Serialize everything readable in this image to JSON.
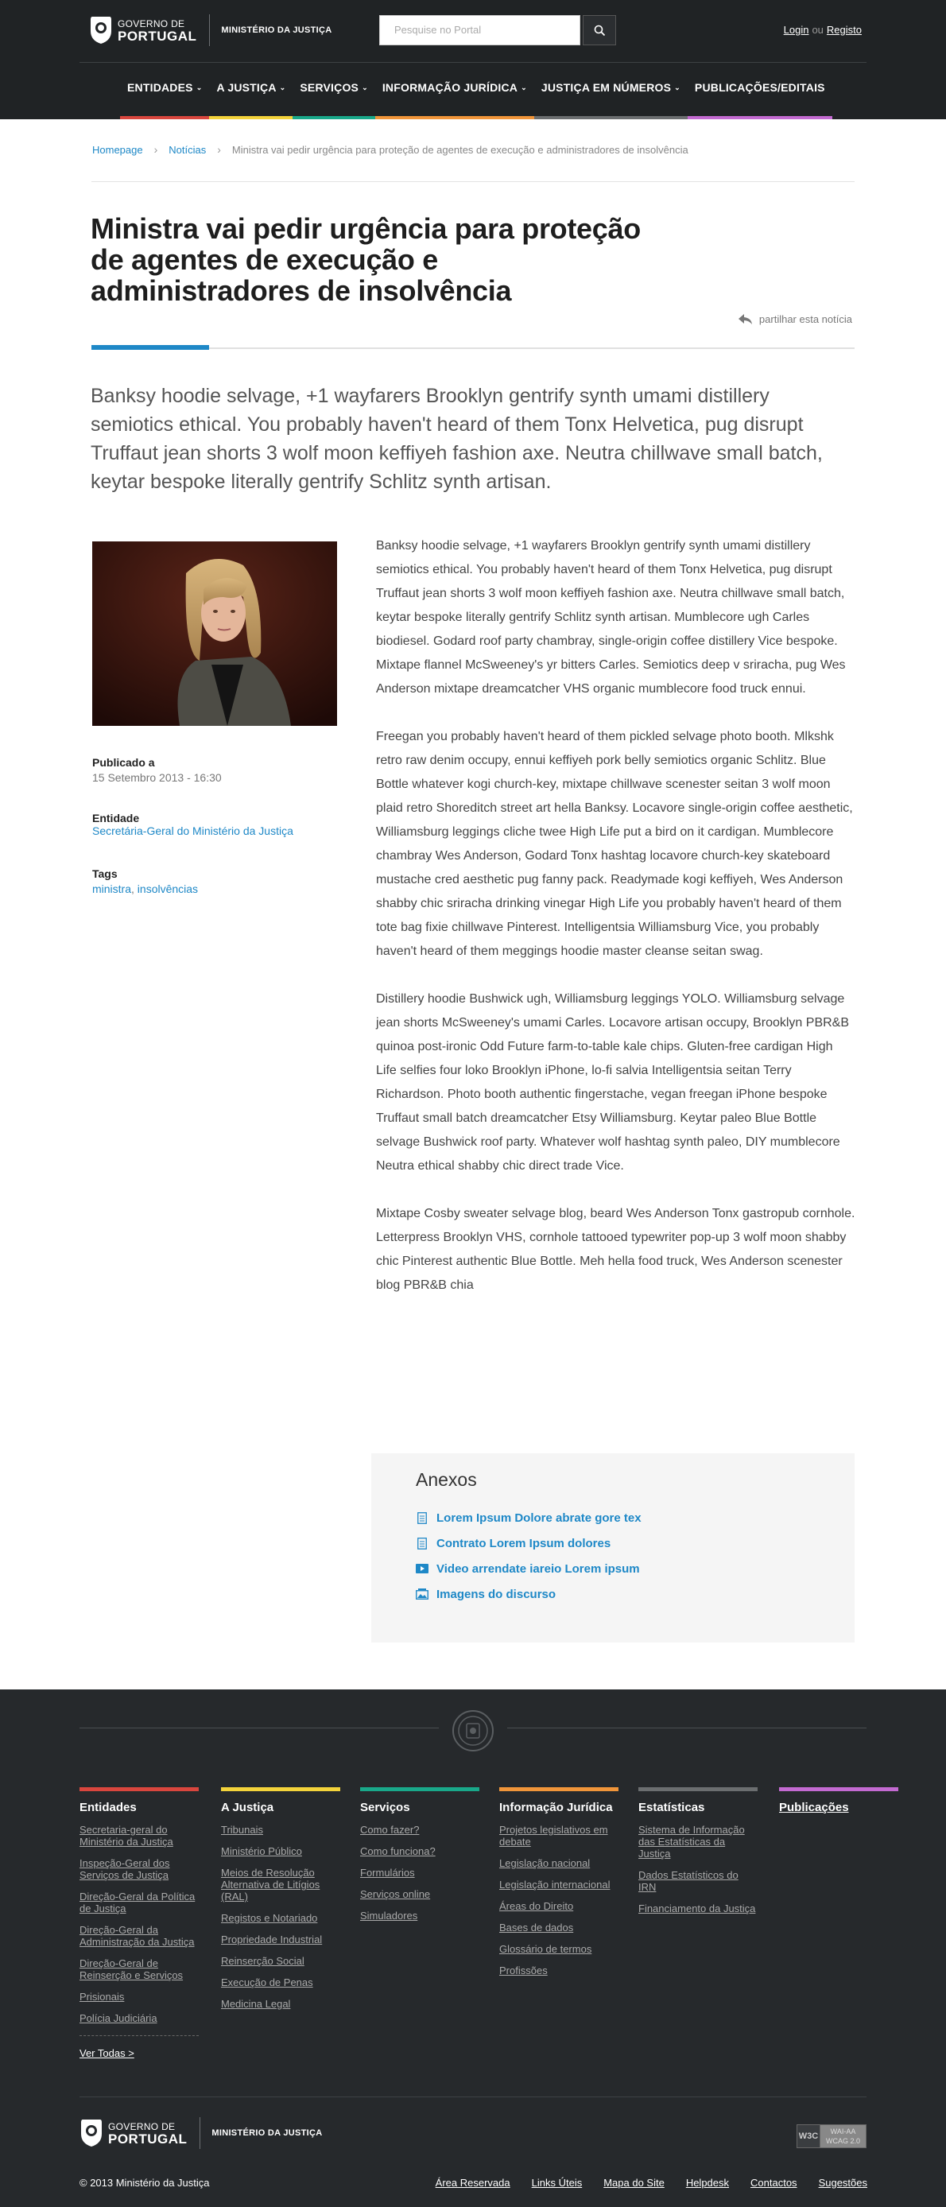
{
  "header": {
    "logo_line1": "GOVERNO DE",
    "logo_line2": "PORTUGAL",
    "ministry": "MINISTÉRIO DA JUSTIÇA",
    "search_placeholder": "Pesquise no Portal",
    "login": "Login",
    "ou": "ou",
    "register": "Registo"
  },
  "nav": [
    {
      "label": "ENTIDADES",
      "color": "#d9463e",
      "dropdown": true
    },
    {
      "label": "A JUSTIÇA",
      "color": "#f3d33b",
      "dropdown": true
    },
    {
      "label": "SERVIÇOS",
      "color": "#19a88a",
      "dropdown": true
    },
    {
      "label": "INFORMAÇÃO JURÍDICA",
      "color": "#f0953a",
      "dropdown": true
    },
    {
      "label": "JUSTIÇA EM NÚMEROS",
      "color": "#6b6e70",
      "dropdown": true
    },
    {
      "label": "PUBLICAÇÕES/EDITAIS",
      "color": "#c36ad1",
      "dropdown": false
    }
  ],
  "breadcrumb": {
    "home": "Homepage",
    "news": "Notícias",
    "current": "Ministra vai pedir urgência para proteção  de agentes de execução e administradores de insolvência"
  },
  "article": {
    "title": "Ministra vai pedir urgência para proteção de agentes de execução e administradores de insolvência",
    "share": "partilhar esta notícia",
    "lead": "Banksy hoodie selvage, +1 wayfarers Brooklyn gentrify synth umami distillery semiotics ethical. You probably haven't heard of them Tonx Helvetica, pug disrupt Truffaut jean shorts 3 wolf moon keffiyeh fashion axe. Neutra chillwave small batch, keytar bespoke literally gentrify Schlitz synth artisan.",
    "published_label": "Publicado a",
    "published_value": "15 Setembro 2013 - 16:30",
    "entity_label": "Entidade",
    "entity_value": "Secretária-Geral do Ministério da Justiça",
    "tags_label": "Tags",
    "tag1": "ministra",
    "tag_sep": ",",
    "tag2": "insolvências",
    "paragraphs": [
      "Banksy hoodie selvage, +1 wayfarers Brooklyn gentrify synth umami distillery semiotics ethical. You probably haven't heard of them Tonx Helvetica, pug disrupt Truffaut jean shorts 3 wolf moon keffiyeh fashion axe. Neutra chillwave small batch, keytar bespoke literally gentrify Schlitz synth artisan. Mumblecore ugh Carles biodiesel. Godard roof party chambray, single-origin coffee distillery Vice bespoke. Mixtape flannel McSweeney's yr bitters Carles. Semiotics deep v sriracha, pug Wes Anderson mixtape dreamcatcher VHS organic mumblecore food truck ennui.",
      "Freegan you probably haven't heard of them pickled selvage photo booth. Mlkshk retro raw denim occupy, ennui keffiyeh pork belly semiotics organic Schlitz. Blue Bottle whatever kogi church-key, mixtape chillwave scenester seitan 3 wolf moon plaid retro Shoreditch street art hella Banksy. Locavore single-origin coffee aesthetic, Williamsburg leggings cliche twee High Life put a bird on it cardigan. Mumblecore chambray Wes Anderson, Godard Tonx hashtag locavore church-key skateboard mustache cred aesthetic pug fanny pack. Readymade kogi keffiyeh, Wes Anderson shabby chic sriracha drinking vinegar High Life you probably haven't heard of them tote bag fixie chillwave Pinterest. Intelligentsia Williamsburg Vice, you probably haven't heard of them meggings hoodie master cleanse seitan swag.",
      "Distillery hoodie Bushwick ugh, Williamsburg leggings YOLO. Williamsburg selvage jean shorts McSweeney's umami Carles. Locavore artisan occupy, Brooklyn PBR&B quinoa post-ironic Odd Future farm-to-table kale chips. Gluten-free cardigan High Life selfies four loko Brooklyn iPhone, lo-fi salvia Intelligentsia seitan Terry Richardson. Photo booth authentic fingerstache, vegan freegan iPhone bespoke Truffaut small batch dreamcatcher Etsy Williamsburg. Keytar paleo Blue Bottle selvage Bushwick roof party. Whatever wolf hashtag synth paleo, DIY mumblecore Neutra ethical shabby chic direct trade Vice.",
      "Mixtape Cosby sweater selvage blog, beard Wes Anderson Tonx gastropub cornhole. Letterpress Brooklyn VHS, cornhole tattooed typewriter pop-up 3 wolf moon shabby chic Pinterest authentic Blue Bottle. Meh hella food truck, Wes Anderson scenester blog PBR&B chia"
    ]
  },
  "anexos": {
    "title": "Anexos",
    "items": [
      {
        "label": "Lorem Ipsum Dolore abrate gore tex",
        "icon": "document-icon"
      },
      {
        "label": "Contrato Lorem Ipsum dolores",
        "icon": "document-icon"
      },
      {
        "label": "Video arrendate iareio Lorem ipsum",
        "icon": "video-icon"
      },
      {
        "label": "Imagens do discurso",
        "icon": "image-icon"
      }
    ]
  },
  "footer": {
    "columns": [
      {
        "title": "Entidades",
        "color": "#d9463e",
        "links": [
          "Secretaria-geral do Ministério da Justiça",
          "Inspeção-Geral dos Serviços de Justiça",
          "Direção-Geral da Política de Justiça",
          "Direção-Geral da Administração da Justiça",
          "Direção-Geral de Reinserção e Serviços",
          "Prisionais",
          "Polícia Judiciária"
        ],
        "more": "Ver Todas >"
      },
      {
        "title": "A Justiça",
        "color": "#f3d33b",
        "links": [
          "Tribunais",
          "Ministério Público",
          "Meios de Resolução Alternativa de Litígios (RAL)",
          "Registos e Notariado",
          "Propriedade Industrial",
          "Reinserção Social",
          "Execução de Penas",
          "Medicina Legal"
        ]
      },
      {
        "title": "Serviços",
        "color": "#19a88a",
        "links": [
          "Como fazer?",
          "Como funciona?",
          "Formulários",
          "Serviços online",
          "Simuladores"
        ]
      },
      {
        "title": "Informação Jurídica",
        "color": "#f0953a",
        "links": [
          "Projetos legislativos em debate",
          "Legislação nacional",
          "Legislação internacional",
          "Áreas do Direito",
          "Bases de dados",
          "Glossário de termos",
          "Profissões"
        ]
      },
      {
        "title": "Estatísticas",
        "color": "#6b6e70",
        "links": [
          "Sistema de Informação das Estatísticas da Justiça",
          "Dados Estatísticos do IRN",
          "Financiamento da Justiça"
        ]
      },
      {
        "title": "Publicações",
        "color": "#c36ad1",
        "links": []
      }
    ],
    "w3c_left": "W3C",
    "w3c_right1": "WAI-AA",
    "w3c_right2": "WCAG 2.0",
    "copyright": "© 2013 Ministério da Justiça",
    "bottom_links": [
      "Área Reservada",
      "Links Úteis",
      "Mapa do Site",
      "Helpdesk",
      "Contactos",
      "Sugestões"
    ]
  }
}
